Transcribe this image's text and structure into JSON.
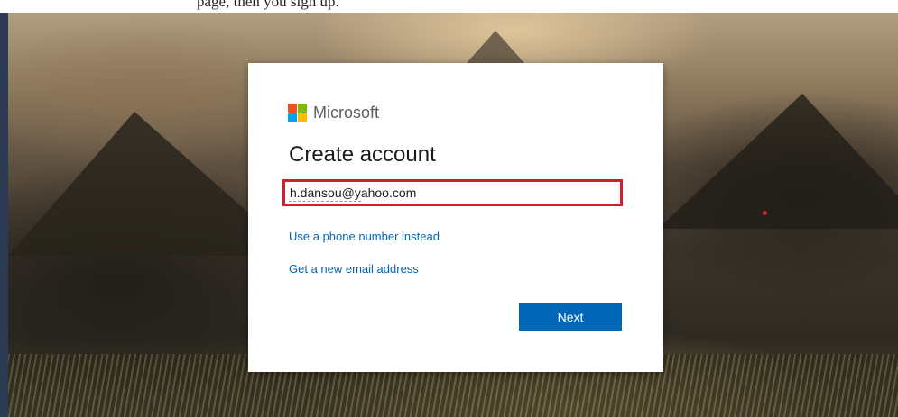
{
  "document": {
    "snippet": "page, then you sign up."
  },
  "dialog": {
    "brand": "Microsoft",
    "title": "Create account",
    "email_value": "h.dansou@yahoo.com",
    "phone_link": "Use a phone number instead",
    "new_email_link": "Get a new email address",
    "next_button": "Next"
  },
  "colors": {
    "accent_blue": "#0067b8",
    "highlight_red": "#d21e2d",
    "logo_red": "#f25022",
    "logo_green": "#7fba00",
    "logo_blue": "#00a4ef",
    "logo_yellow": "#ffb900"
  },
  "icons": {
    "logo": "microsoft-logo-icon"
  }
}
